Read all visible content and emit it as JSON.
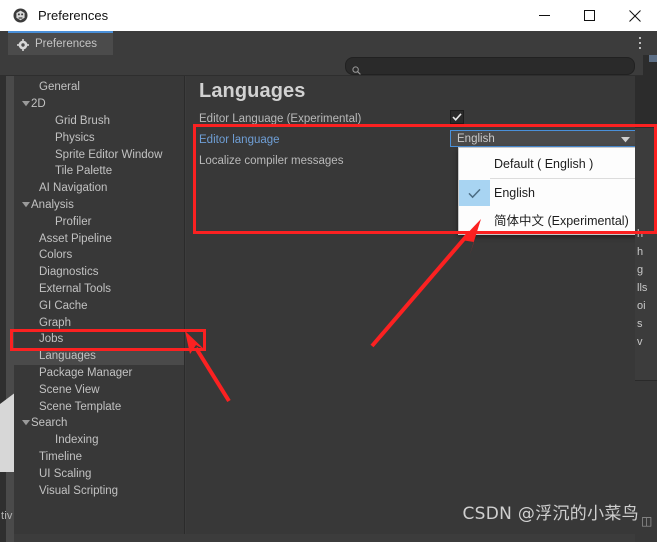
{
  "window": {
    "title": "Preferences",
    "icon": "unity-logo-icon",
    "controls": {
      "minimize": "minimize-icon",
      "maximize": "maximize-icon",
      "close": "close-icon"
    }
  },
  "tabbar": {
    "tab_label": "Preferences",
    "tab_icon": "gear-icon",
    "menu_icon": "kebab-menu-icon"
  },
  "toolbar": {
    "search_icon": "search-icon",
    "search_value": "",
    "search_placeholder": ""
  },
  "sidebar": {
    "items": [
      {
        "label": "General",
        "indent": 1,
        "twisty": "none",
        "selected": false
      },
      {
        "label": "2D",
        "indent": 0,
        "twisty": "expanded",
        "selected": false
      },
      {
        "label": "Grid Brush",
        "indent": 2,
        "twisty": "none",
        "selected": false
      },
      {
        "label": "Physics",
        "indent": 2,
        "twisty": "none",
        "selected": false
      },
      {
        "label": "Sprite Editor Window",
        "indent": 2,
        "twisty": "none",
        "selected": false
      },
      {
        "label": "Tile Palette",
        "indent": 2,
        "twisty": "none",
        "selected": false
      },
      {
        "label": "AI Navigation",
        "indent": 1,
        "twisty": "none",
        "selected": false
      },
      {
        "label": "Analysis",
        "indent": 0,
        "twisty": "expanded",
        "selected": false
      },
      {
        "label": "Profiler",
        "indent": 2,
        "twisty": "none",
        "selected": false
      },
      {
        "label": "Asset Pipeline",
        "indent": 1,
        "twisty": "none",
        "selected": false
      },
      {
        "label": "Colors",
        "indent": 1,
        "twisty": "none",
        "selected": false
      },
      {
        "label": "Diagnostics",
        "indent": 1,
        "twisty": "none",
        "selected": false
      },
      {
        "label": "External Tools",
        "indent": 1,
        "twisty": "none",
        "selected": false
      },
      {
        "label": "GI Cache",
        "indent": 1,
        "twisty": "none",
        "selected": false
      },
      {
        "label": "Graph",
        "indent": 1,
        "twisty": "none",
        "selected": false
      },
      {
        "label": "Jobs",
        "indent": 1,
        "twisty": "none",
        "selected": false
      },
      {
        "label": "Languages",
        "indent": 1,
        "twisty": "none",
        "selected": true
      },
      {
        "label": "Package Manager",
        "indent": 1,
        "twisty": "none",
        "selected": false
      },
      {
        "label": "Scene View",
        "indent": 1,
        "twisty": "none",
        "selected": false
      },
      {
        "label": "Scene Template",
        "indent": 1,
        "twisty": "none",
        "selected": false
      },
      {
        "label": "Search",
        "indent": 0,
        "twisty": "expanded",
        "selected": false
      },
      {
        "label": "Indexing",
        "indent": 2,
        "twisty": "none",
        "selected": false
      },
      {
        "label": "Timeline",
        "indent": 1,
        "twisty": "none",
        "selected": false
      },
      {
        "label": "UI Scaling",
        "indent": 1,
        "twisty": "none",
        "selected": false
      },
      {
        "label": "Visual Scripting",
        "indent": 1,
        "twisty": "none",
        "selected": false
      }
    ]
  },
  "main": {
    "title": "Languages",
    "rows": {
      "editor_language_experimental": "Editor Language (Experimental)",
      "editor_language": "Editor language",
      "localize_compiler_messages": "Localize compiler messages"
    },
    "checkbox": {
      "checked": true,
      "icon": "checkmark-icon"
    },
    "dropdown": {
      "selected_value": "English",
      "caret_icon": "chevron-down-icon",
      "open": true,
      "options": [
        {
          "label": "Default ( English )",
          "checked": false
        },
        {
          "label": "English",
          "checked": true
        },
        {
          "label": "简体中文 (Experimental)",
          "checked": false
        }
      ]
    }
  },
  "background": {
    "left_edge_text": "tiv",
    "right_edge_lines": [
      "h",
      "h",
      "g",
      "lls",
      "oi",
      "s",
      "v"
    ]
  },
  "annotations": {
    "box_dropdown": "highlight-box-language-dropdown",
    "box_sidebar": "highlight-box-sidebar-languages",
    "arrow_to_dropdown": "arrow-pointing-to-dropdown",
    "arrow_to_sidebar": "arrow-pointing-to-sidebar-languages",
    "color": "#fb2121"
  },
  "watermark": "CSDN @浮沉的小菜鸟"
}
